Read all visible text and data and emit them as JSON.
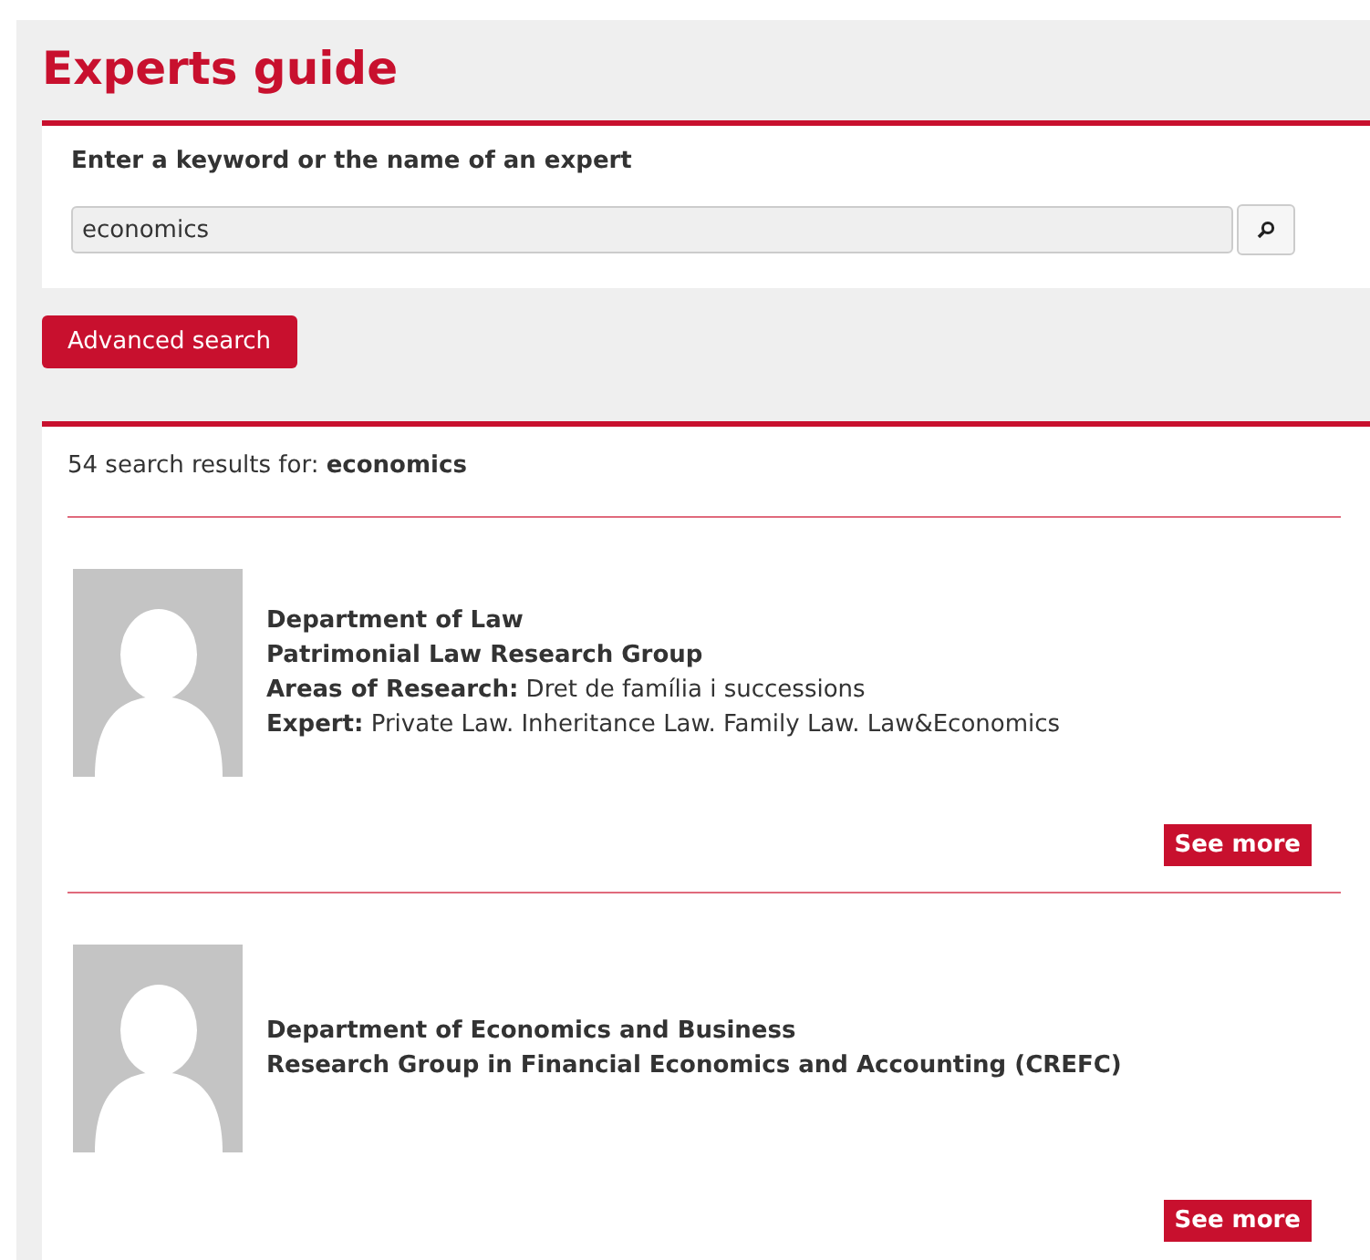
{
  "page_title": "Experts guide",
  "search": {
    "label": "Enter a keyword or the name of an expert",
    "value": "economics"
  },
  "advanced_button": "Advanced search",
  "results_summary": {
    "text": "54 search results for:",
    "query": "economics"
  },
  "results": [
    {
      "department": "Department of Law",
      "group": "Patrimonial Law Research Group",
      "fields": [
        {
          "label": "Areas of Research:",
          "value": "Dret de família i successions"
        },
        {
          "label": "Expert:",
          "value": "Private Law. Inheritance Law. Family Law. Law&Economics"
        }
      ],
      "button": "See more"
    },
    {
      "department": "Department of Economics and Business",
      "group": "Research Group in Financial Economics and Accounting (CREFC)",
      "button": "See more"
    }
  ]
}
